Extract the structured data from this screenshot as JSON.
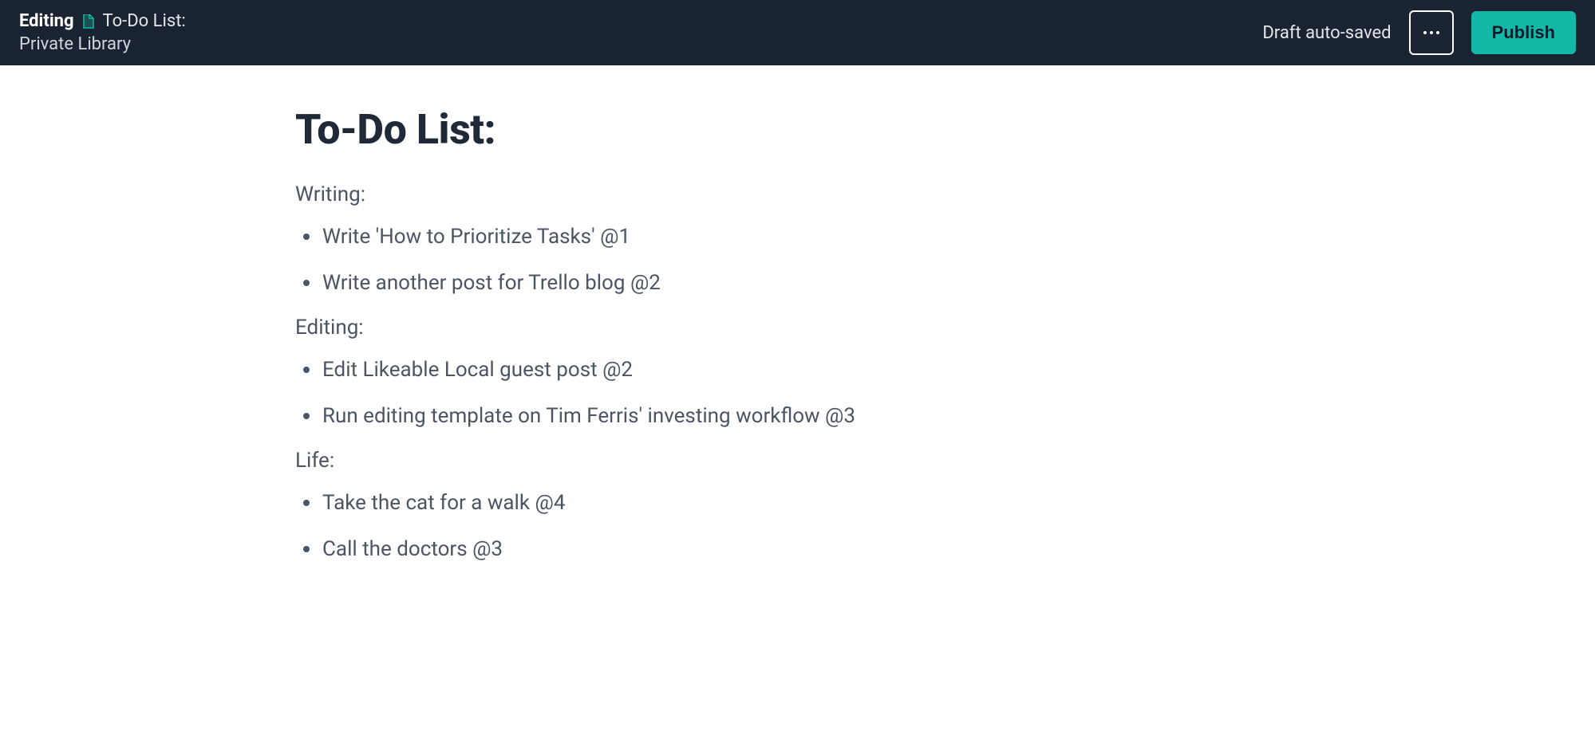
{
  "header": {
    "editing_label": "Editing",
    "doc_title": "To-Do List:",
    "library_label": "Private Library",
    "draft_saved": "Draft auto-saved",
    "publish_label": "Publish"
  },
  "content": {
    "title": "To-Do List:",
    "sections": [
      {
        "label": "Writing:",
        "items": [
          "Write 'How to Prioritize Tasks' @1",
          "Write another post for Trello blog @2"
        ]
      },
      {
        "label": "Editing:",
        "items": [
          "Edit Likeable Local guest post @2",
          "Run editing template on Tim Ferris' investing workflow @3"
        ]
      },
      {
        "label": "Life:",
        "items": [
          "Take the cat for a walk @4",
          "Call the doctors @3"
        ]
      }
    ]
  }
}
